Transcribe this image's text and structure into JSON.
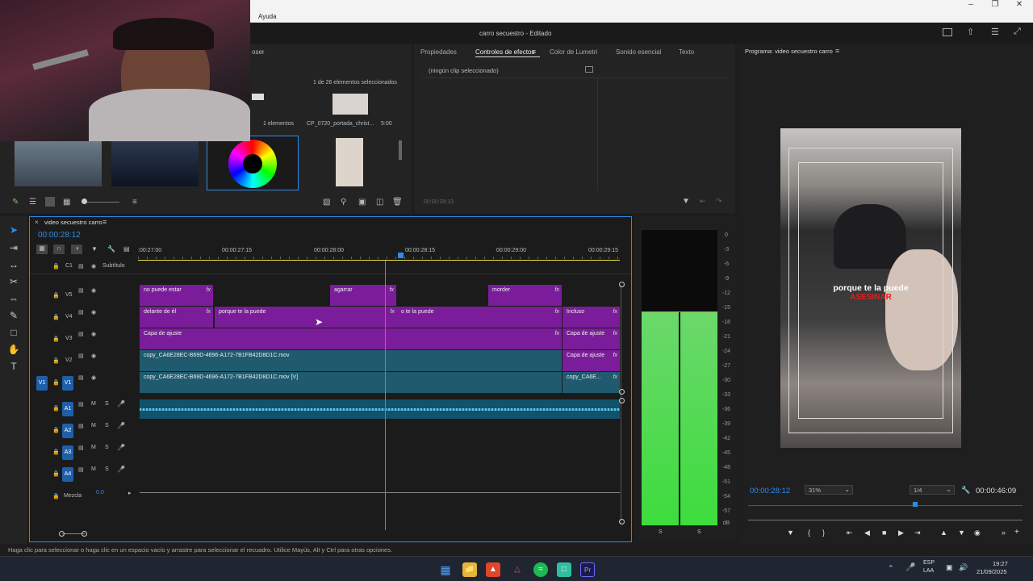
{
  "menubar": {
    "help_label": "Ayuda"
  },
  "title": {
    "project": "carro secuestro",
    "status": "- Editado"
  },
  "project_panel": {
    "tab_partial": "oser",
    "selection_info": "1 de 26 elementos seleccionados",
    "items_count": "1 elementos",
    "item_name": "CP_0720_portada_christ...",
    "item_duration": "5:00"
  },
  "effects_panel": {
    "tabs": [
      "Propiedades",
      "Controles de efectos",
      "Color de Lumetri",
      "Sonido esencial",
      "Texto"
    ],
    "no_clip": "(ningún clip seleccionado)",
    "timecode": "00:00:28:13"
  },
  "program_monitor": {
    "title": "Programa: video secuestro carro",
    "timecode": "00:00:28:12",
    "zoom": "31%",
    "resolution": "1/4",
    "duration": "00:00:46:09",
    "subtitle_line1": "porque te la puede",
    "subtitle_line2": "ASESINAR"
  },
  "timeline": {
    "sequence_name": "video secuestro carro",
    "timecode": "00:00:28:12",
    "ruler_labels": [
      ":00:27:00",
      "00:00:27:15",
      "00:00:28:00",
      "00:00:28:15",
      "00:00:29:00",
      "00:00:29:15"
    ],
    "tracks": {
      "c1": "C1",
      "subtitle": "Subtítulo",
      "v5": "V5",
      "v4": "V4",
      "v3": "V3",
      "v2": "V2",
      "v1": "V1",
      "a1": "A1",
      "a2": "A2",
      "a3": "A3",
      "a4": "A4",
      "mix": "Mezcla",
      "mix_value": "0.0",
      "m": "M",
      "s": "S"
    },
    "clips": {
      "v5_a": "no puede estar",
      "v5_b": "agarrar",
      "v5_c": "morder",
      "v4_a": "delante de él",
      "v4_b": "porque te la puede",
      "v4_c": "o te la puede",
      "v4_d": "Incluso",
      "v3_a": "Capa de ajuste",
      "v3_b": "Capa de ajuste",
      "v2_a": "copy_CA6E28EC-B69D-4696-A172-7B1FB42D8D1C.mov",
      "v2_b": "Capa de ajuste",
      "v1_a": "copy_CA6E28EC-B69D-4696-A172-7B1FB42D8D1C.mov [V]",
      "v1_b": "copy_CA6E...",
      "fx": "fx"
    }
  },
  "audio_meter": {
    "scale": [
      "0",
      "-3",
      "-6",
      "-9",
      "-12",
      "-15",
      "-18",
      "-21",
      "-24",
      "-27",
      "-30",
      "-33",
      "-36",
      "-39",
      "-42",
      "-45",
      "-48",
      "-51",
      "-54",
      "-57",
      "dB"
    ],
    "solo": "S"
  },
  "status_bar": "Haga clic para seleccionar o haga clic en un espacio vacío y arrastre para seleccionar el recuadro. Utilice Mayús, Alt y Ctrl para otras opciones.",
  "taskbar": {
    "lang1": "ESP",
    "lang2": "LAA",
    "time": "19:27",
    "date": "21/09/2025"
  },
  "colors": {
    "accent_blue": "#2d8ceb",
    "clip_purple": "#7b1d9a",
    "clip_teal": "#1f5a6e",
    "meter_green": "#3ddc3d"
  },
  "icons": [
    "minimize-icon",
    "maximize-icon",
    "close-icon",
    "selection-tool-icon",
    "track-select-icon",
    "ripple-edit-icon",
    "razor-icon",
    "slip-icon",
    "pen-icon",
    "rectangle-icon",
    "hand-icon",
    "type-icon",
    "filter-icon",
    "wrench-icon",
    "play-icon",
    "step-back-icon",
    "step-forward-icon",
    "camera-icon",
    "windows-icon",
    "folder-icon",
    "brave-icon",
    "spotify-icon",
    "premiere-icon"
  ]
}
